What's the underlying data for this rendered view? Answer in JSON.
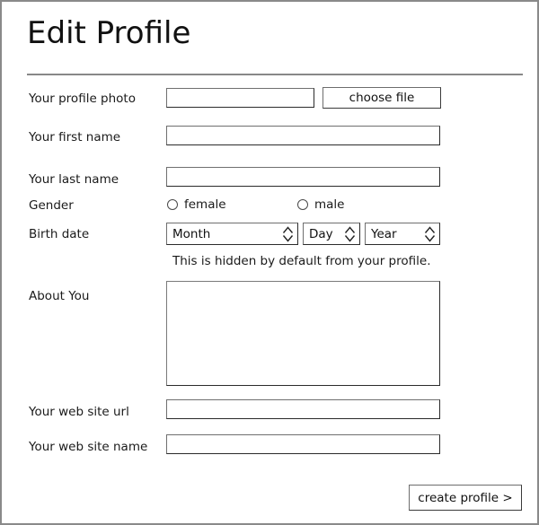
{
  "window": {
    "title": "Edit Profile",
    "border_color": "#8a8a8a",
    "background": "#ffffff",
    "divider_color": "#888888"
  },
  "form": {
    "profile_photo": {
      "label": "Your profile photo",
      "input_value": "",
      "input_placeholder": "",
      "button_label": "choose file"
    },
    "first_name": {
      "label": "Your first name",
      "value": "",
      "placeholder": ""
    },
    "last_name": {
      "label": "Your last name",
      "value": "",
      "placeholder": ""
    },
    "gender": {
      "label": "Gender",
      "options": [
        {
          "label": "female",
          "selected": false
        },
        {
          "label": "male",
          "selected": false
        }
      ]
    },
    "birth_date": {
      "label": "Birth date",
      "month": {
        "selected": "Month",
        "icon": "spinner-arrows-icon"
      },
      "day": {
        "selected": "Day",
        "icon": "spinner-arrows-icon"
      },
      "year": {
        "selected": "Year",
        "icon": "spinner-arrows-icon"
      },
      "hint": "This is hidden by default from your profile."
    },
    "about_you": {
      "label": "About You",
      "value": "",
      "placeholder": ""
    },
    "web_site_url": {
      "label": "Your web site url",
      "value": "",
      "placeholder": ""
    },
    "web_site_name": {
      "label": "Your web site name",
      "value": "",
      "placeholder": ""
    }
  },
  "footer": {
    "submit_label": "create profile >"
  }
}
